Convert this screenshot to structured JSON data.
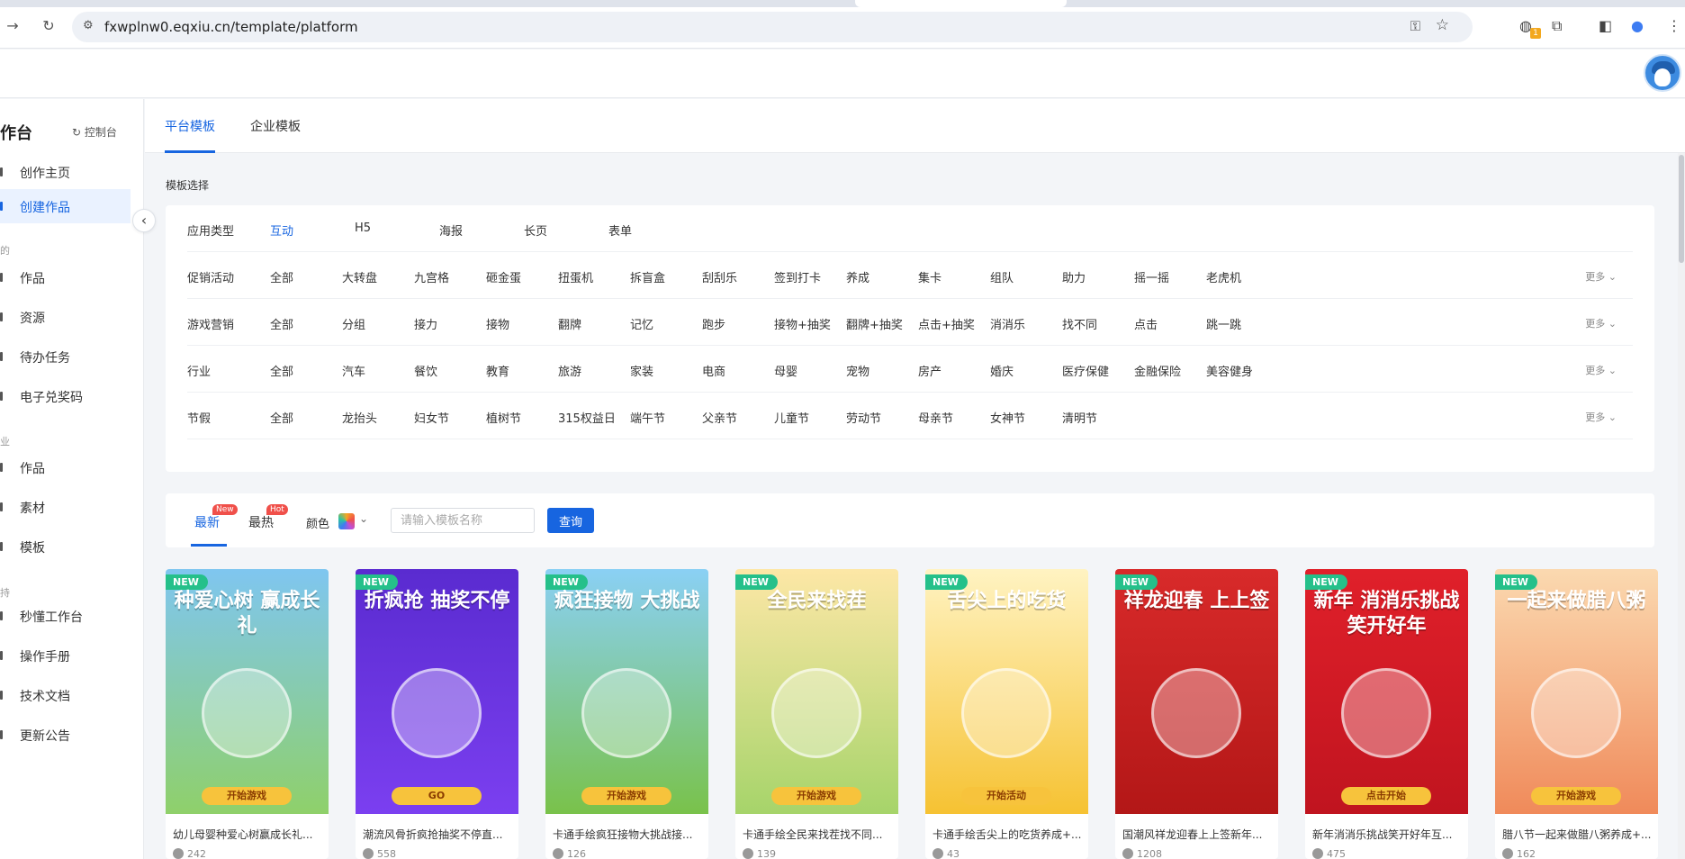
{
  "browser": {
    "url": "fxwplnw0.eqxiu.cn/template/platform",
    "ext_badge": "1"
  },
  "sidebar": {
    "title": "作台",
    "console_label": "控制台",
    "items": [
      {
        "label": "创作主页"
      },
      {
        "label": "创建作品"
      },
      {
        "label": "作品"
      },
      {
        "label": "资源"
      },
      {
        "label": "待办任务"
      },
      {
        "label": "电子兑奖码"
      },
      {
        "label": "作品"
      },
      {
        "label": "素材"
      },
      {
        "label": "模板"
      },
      {
        "label": "秒懂工作台"
      },
      {
        "label": "操作手册"
      },
      {
        "label": "技术文档"
      },
      {
        "label": "更新公告"
      }
    ],
    "groups": [
      "的",
      "业",
      "持"
    ]
  },
  "tabs": [
    {
      "label": "平台模板"
    },
    {
      "label": "企业模板"
    }
  ],
  "section_label": "模板选择",
  "filters": [
    {
      "label": "应用类型",
      "options": [
        "互动",
        "H5",
        "海报",
        "长页",
        "表单"
      ],
      "more": ""
    },
    {
      "label": "促销活动",
      "options": [
        "全部",
        "大转盘",
        "九宫格",
        "砸金蛋",
        "扭蛋机",
        "拆盲盒",
        "刮刮乐",
        "签到打卡",
        "养成",
        "集卡",
        "组队",
        "助力",
        "摇一摇",
        "老虎机"
      ],
      "more": "更多"
    },
    {
      "label": "游戏营销",
      "options": [
        "全部",
        "分组",
        "接力",
        "接物",
        "翻牌",
        "记忆",
        "跑步",
        "接物+抽奖",
        "翻牌+抽奖",
        "点击+抽奖",
        "消消乐",
        "找不同",
        "点击",
        "跳一跳"
      ],
      "more": "更多"
    },
    {
      "label": "行业",
      "options": [
        "全部",
        "汽车",
        "餐饮",
        "教育",
        "旅游",
        "家装",
        "电商",
        "母婴",
        "宠物",
        "房产",
        "婚庆",
        "医疗保健",
        "金融保险",
        "美容健身"
      ],
      "more": "更多"
    },
    {
      "label": "节假",
      "options": [
        "全部",
        "龙抬头",
        "妇女节",
        "植树节",
        "315权益日",
        "端午节",
        "父亲节",
        "儿童节",
        "劳动节",
        "母亲节",
        "女神节",
        "清明节"
      ],
      "more": "更多"
    }
  ],
  "search": {
    "sort_newest": "最新",
    "sort_newest_badge": "New",
    "sort_hot": "最热",
    "sort_hot_badge": "Hot",
    "color_label": "颜色",
    "placeholder": "请输入模板名称",
    "button": "查询"
  },
  "cards": [
    {
      "tag": "NEW",
      "poster": "种爱心树 赢成长礼",
      "button": "开始游戏",
      "title": "幼儿母婴种爱心树赢成长礼...",
      "views": "242",
      "bg1": "#7fc6f0",
      "bg2": "#8fd06a"
    },
    {
      "tag": "NEW",
      "poster": "折疯抢 抽奖不停",
      "button": "GO",
      "title": "潮流风骨折疯抢抽奖不停直...",
      "views": "558",
      "bg1": "#5a2bd0",
      "bg2": "#7b3ff0"
    },
    {
      "tag": "NEW",
      "poster": "疯狂接物 大挑战",
      "button": "开始游戏",
      "title": "卡通手绘疯狂接物大挑战接...",
      "views": "126",
      "bg1": "#8ad0f5",
      "bg2": "#79c24a"
    },
    {
      "tag": "NEW",
      "poster": "全民来找茬",
      "button": "开始游戏",
      "title": "卡通手绘全民来找茬找不同...",
      "views": "139",
      "bg1": "#fde7a6",
      "bg2": "#a6d46a"
    },
    {
      "tag": "NEW",
      "poster": "舌尖上的吃货",
      "button": "开始活动",
      "title": "卡通手绘舌尖上的吃货养成+...",
      "views": "43",
      "bg1": "#fff3c2",
      "bg2": "#f6c232"
    },
    {
      "tag": "NEW",
      "poster": "祥龙迎春 上上签",
      "button": "",
      "title": "国潮风祥龙迎春上上签新年...",
      "views": "1208",
      "bg1": "#d82a2a",
      "bg2": "#b31717"
    },
    {
      "tag": "NEW",
      "poster": "新年 消消乐挑战 笑开好年",
      "button": "点击开始",
      "title": "新年消消乐挑战笑开好年互...",
      "views": "475",
      "bg1": "#e0202a",
      "bg2": "#c0141f"
    },
    {
      "tag": "NEW",
      "poster": "一起来做腊八粥",
      "button": "开始游戏",
      "title": "腊八节一起来做腊八粥养成+...",
      "views": "162",
      "bg1": "#fbd9b0",
      "bg2": "#f08a5a"
    }
  ]
}
